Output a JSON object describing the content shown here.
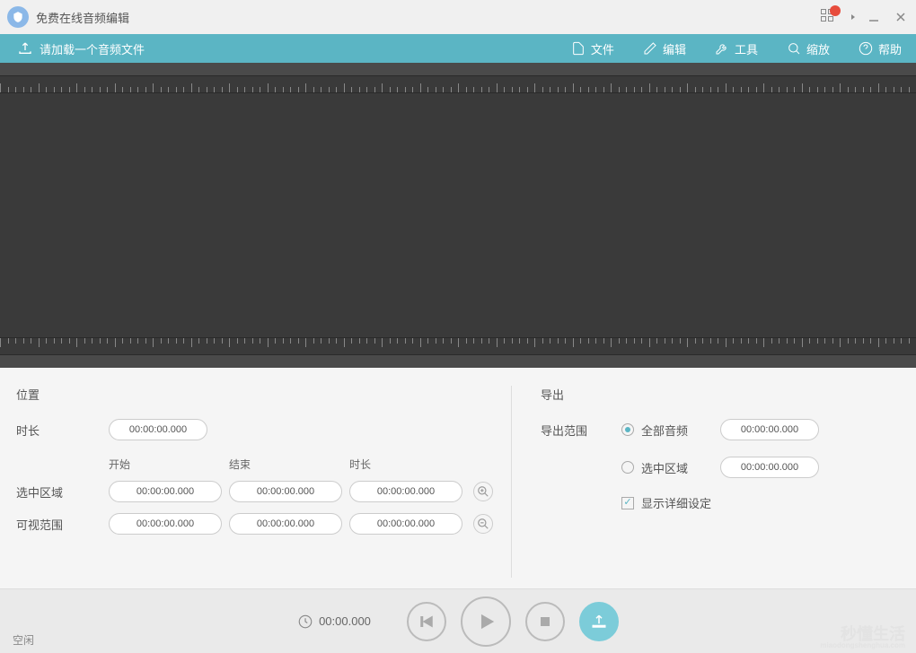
{
  "app": {
    "title": "免费在线音频编辑"
  },
  "toolbar": {
    "load_prompt": "请加载一个音频文件",
    "file": "文件",
    "edit": "编辑",
    "tools": "工具",
    "zoom": "缩放",
    "help": "帮助"
  },
  "position": {
    "header": "位置",
    "duration_label": "时长",
    "duration_value": "00:00:00.000",
    "start_label": "开始",
    "end_label": "结束",
    "length_label": "时长",
    "selection_label": "选中区域",
    "selection_start": "00:00:00.000",
    "selection_end": "00:00:00.000",
    "selection_length": "00:00:00.000",
    "visible_label": "可视范围",
    "visible_start": "00:00:00.000",
    "visible_end": "00:00:00.000",
    "visible_length": "00:00:00.000"
  },
  "export": {
    "header": "导出",
    "range_label": "导出范围",
    "all_audio": "全部音频",
    "all_audio_time": "00:00:00.000",
    "selected": "选中区域",
    "selected_time": "00:00:00.000",
    "show_details": "显示详细设定"
  },
  "playback": {
    "time": "00:00.000",
    "status": "空闲"
  },
  "watermark": {
    "title": "秒懂生活",
    "subtitle": "miaodongshenghua.com"
  }
}
